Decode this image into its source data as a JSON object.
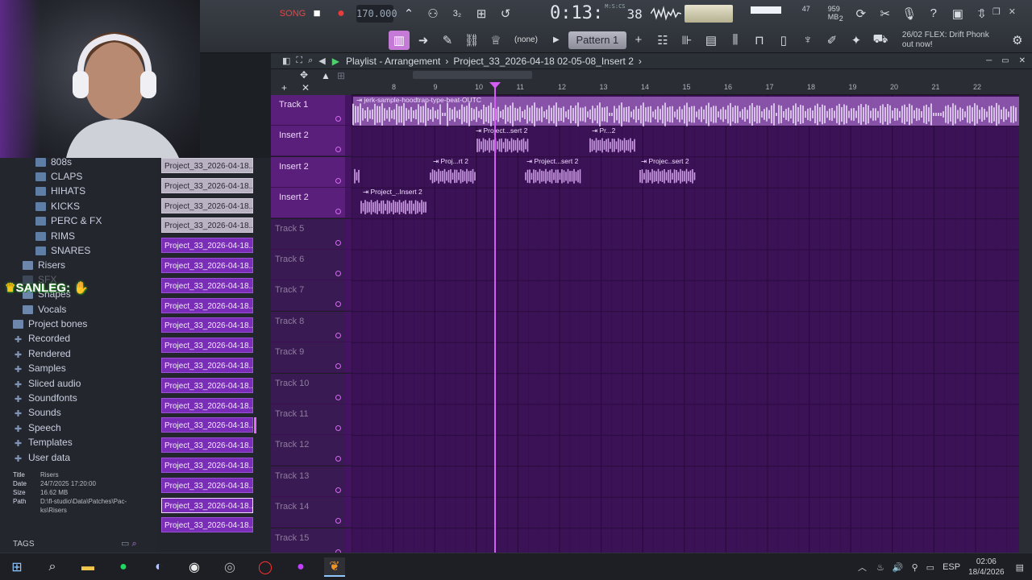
{
  "toolbar": {
    "tempo": "170.000",
    "time_main": "0:13:",
    "time_frac": "38",
    "time_unit": "M:S:CS",
    "cpu_value": "47",
    "ram_value": "959 MB",
    "poly_value": "2",
    "none_label": "(none)",
    "pattern_label": "Pattern 1",
    "news_line1": "26/02  FLEX: Drift Phonk",
    "news_line2": "out now!"
  },
  "playlist": {
    "title": "Playlist - Arrangement",
    "breadcrumb": "Project_33_2026-04-18 02-05-08_Insert 2",
    "ruler_ticks": [
      "8",
      "9",
      "10",
      "11",
      "12",
      "13",
      "14",
      "15",
      "16",
      "17",
      "18",
      "19",
      "20",
      "21",
      "22"
    ],
    "tracks": [
      {
        "label": "Track 1"
      },
      {
        "label": "Insert 2"
      },
      {
        "label": "Insert 2"
      },
      {
        "label": "Insert 2"
      },
      {
        "label": "Track 5"
      },
      {
        "label": "Track 6"
      },
      {
        "label": "Track 7"
      },
      {
        "label": "Track 8"
      },
      {
        "label": "Track 9"
      },
      {
        "label": "Track 10"
      },
      {
        "label": "Track 11"
      },
      {
        "label": "Track 12"
      },
      {
        "label": "Track 13"
      },
      {
        "label": "Track 14"
      },
      {
        "label": "Track 15"
      }
    ],
    "clips": {
      "c1": "jerk-sample-hoodtrap-type-beat-OUTC",
      "c2": "Project...sert 2",
      "c3": "Pr...2",
      "c4": "Proj...rt 2",
      "c5": "Project...sert 2",
      "c6": "Projec..sert 2",
      "c7": "Project_..Insert 2"
    }
  },
  "browser": {
    "items": [
      {
        "label": "808s"
      },
      {
        "label": "CLAPS"
      },
      {
        "label": "HIHATS"
      },
      {
        "label": "KICKS"
      },
      {
        "label": "PERC & FX"
      },
      {
        "label": "RIMS"
      },
      {
        "label": "SNARES"
      },
      {
        "label": "Risers"
      },
      {
        "label": "SFX"
      },
      {
        "label": "Shapes"
      },
      {
        "label": "Vocals"
      },
      {
        "label": "Project bones"
      },
      {
        "label": "Recorded"
      },
      {
        "label": "Rendered"
      },
      {
        "label": "Samples"
      },
      {
        "label": "Sliced audio"
      },
      {
        "label": "Soundfonts"
      },
      {
        "label": "Sounds"
      },
      {
        "label": "Speech"
      },
      {
        "label": "Templates"
      },
      {
        "label": "User data"
      }
    ],
    "overlay_name": "SANLEG:",
    "info": {
      "title_key": "Title",
      "title_val": "Risers",
      "date_key": "Date",
      "date_val": "24/7/2025 17:20:00",
      "size_key": "Size",
      "size_val": "16.62 MB",
      "path_key": "Path",
      "path_val1": "D:\\fl-studio\\Data\\Patches\\Pac-",
      "path_val2": "ks\\Risers"
    },
    "tags_label": "TAGS"
  },
  "cliplist": {
    "item_label": "Project_33_2026-04-18...",
    "count": 19
  },
  "taskbar": {
    "lang": "ESP",
    "time": "02:06",
    "date": "18/4/2026"
  },
  "colors": {
    "accent_purple": "#7a2db7",
    "track_purple": "#5a1f7a",
    "grid_purple": "#3c1257",
    "playhead": "#d55cf5",
    "record_red": "#e83b3b",
    "play_green": "#4ed06e"
  }
}
